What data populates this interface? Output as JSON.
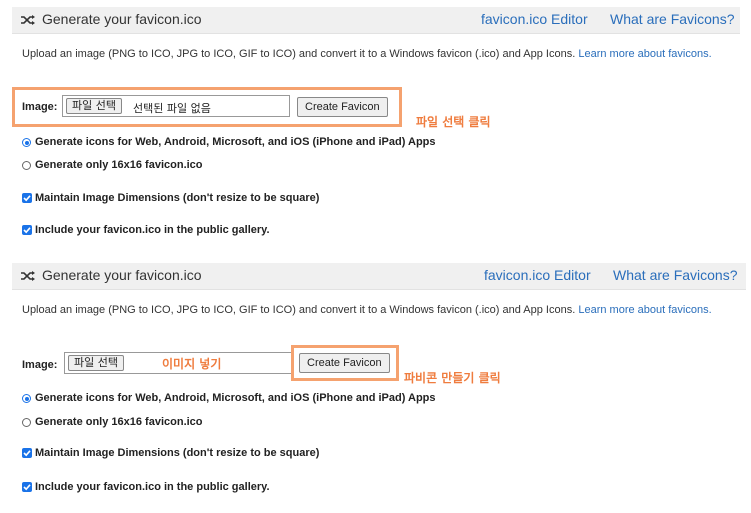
{
  "panels": [
    {
      "title": "Generate your favicon.ico",
      "links": {
        "editor": "favicon.ico Editor",
        "what": "What are Favicons?"
      },
      "description": "Upload an image (PNG to ICO, JPG to ICO, GIF to ICO) and convert it to a Windows favicon (.ico) and App Icons.",
      "learn_more": "Learn more about favicons.",
      "image_label": "Image:",
      "file_button": "파일 선택",
      "file_status": "선택된 파일 없음",
      "create_button": "Create Favicon",
      "annotation": "파일 선택 클릭",
      "options": {
        "radio1": "Generate icons for Web, Android, Microsoft, and iOS (iPhone and iPad) Apps",
        "radio2": "Generate only 16x16 favicon.ico",
        "check1": "Maintain Image Dimensions (don't resize to be square)",
        "check2": "Include your favicon.ico in the public gallery."
      }
    },
    {
      "title": "Generate your favicon.ico",
      "links": {
        "editor": "favicon.ico Editor",
        "what": "What are Favicons?"
      },
      "description": "Upload an image (PNG to ICO, JPG to ICO, GIF to ICO) and convert it to a Windows favicon (.ico) and App Icons.",
      "learn_more": "Learn more about favicons.",
      "image_label": "Image:",
      "file_button": "파일 선택",
      "file_annotation": "이미지 넣기",
      "create_button": "Create Favicon",
      "annotation": "파비콘 만들기 클릭",
      "options": {
        "radio1": "Generate icons for Web, Android, Microsoft, and iOS (iPhone and iPad) Apps",
        "radio2": "Generate only 16x16 favicon.ico",
        "check1": "Maintain Image Dimensions (don't resize to be square)",
        "check2": "Include your favicon.ico in the public gallery."
      }
    }
  ],
  "colors": {
    "link": "#2a6ebb",
    "annotation": "#ef7c3e",
    "highlight": "#f5a26f",
    "accent": "#1a73e8"
  }
}
